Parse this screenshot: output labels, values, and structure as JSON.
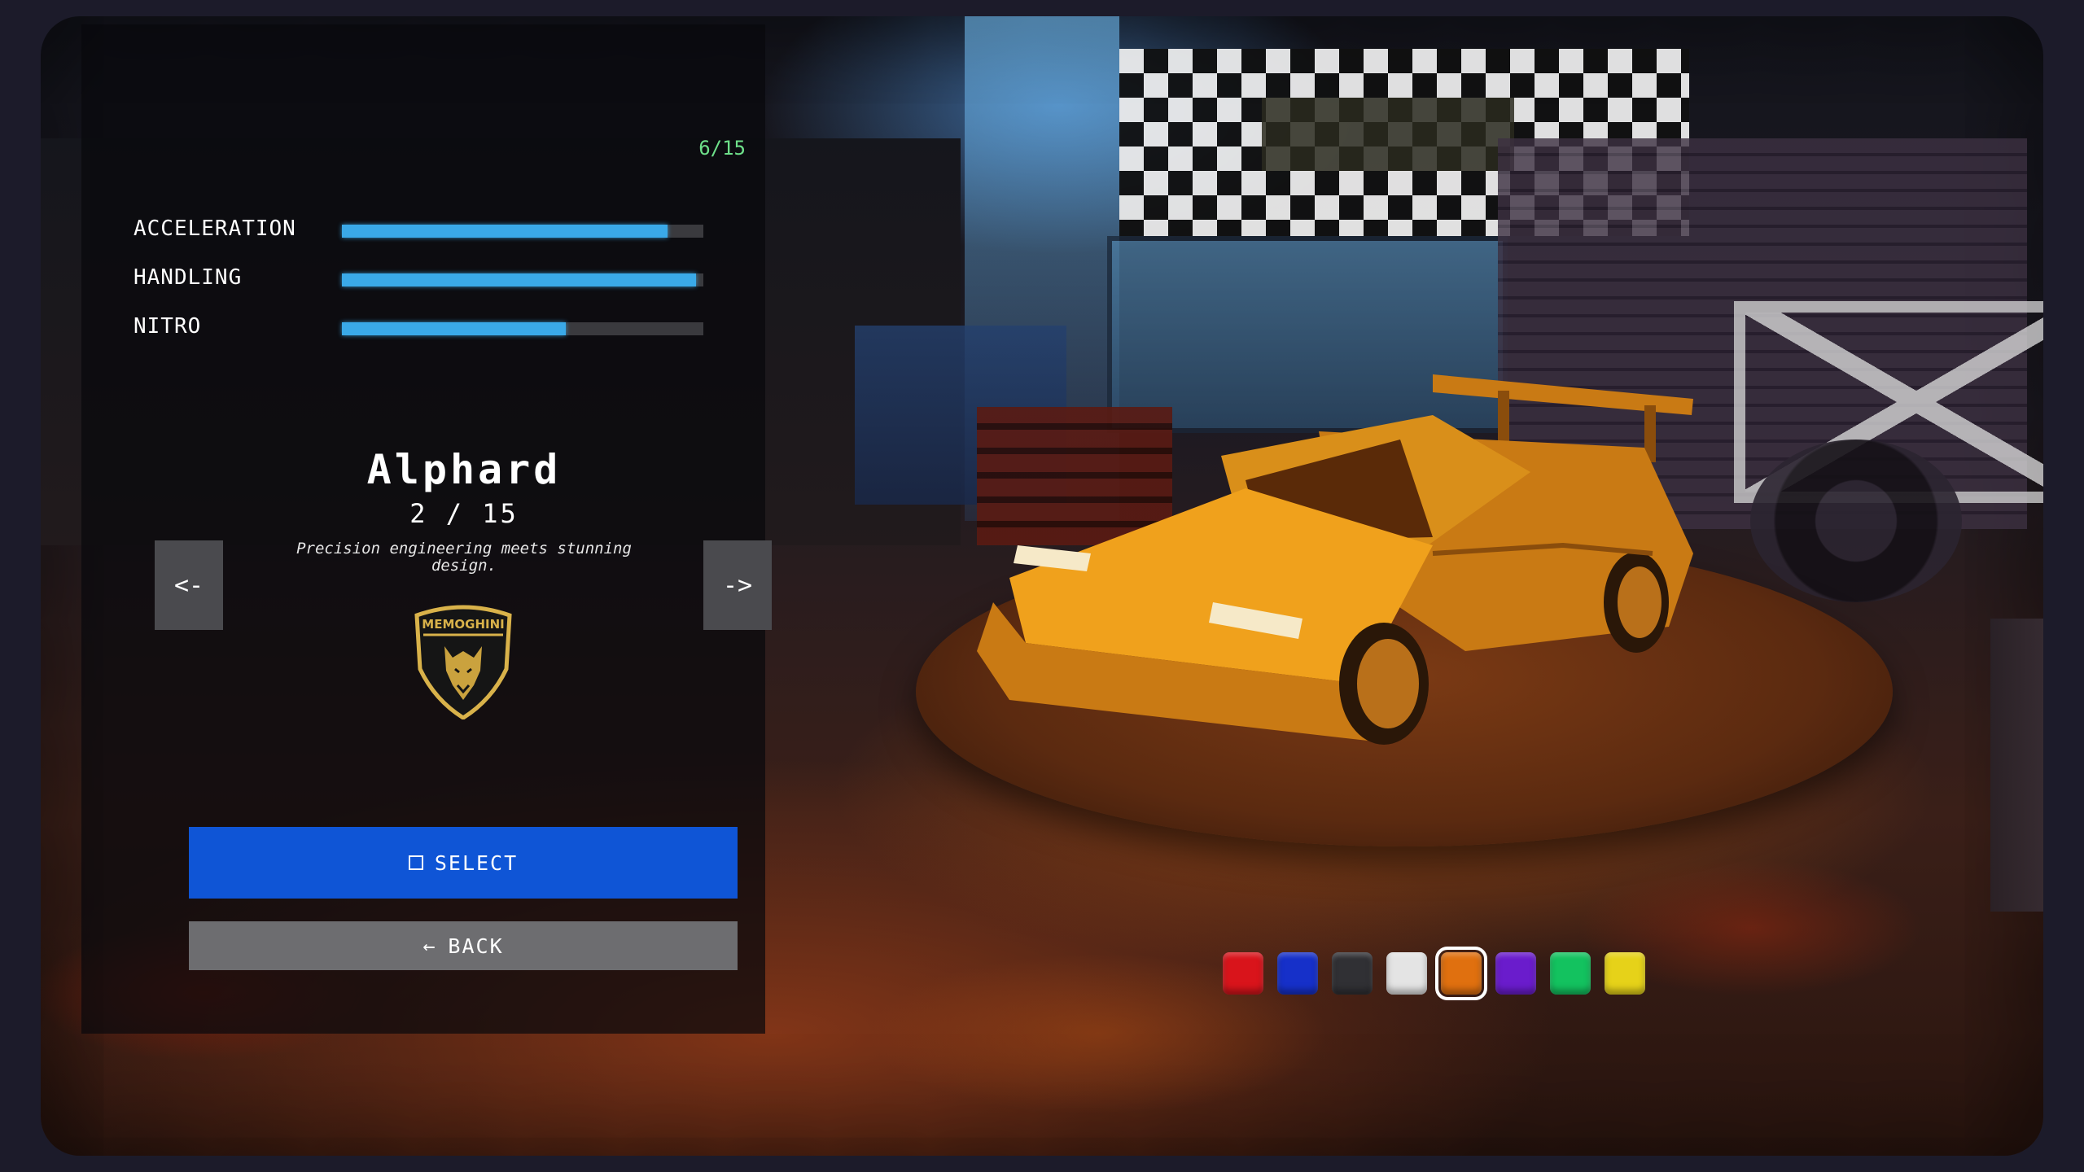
{
  "stats": {
    "unlock_count": "6/15",
    "items": [
      {
        "label": "ACCELERATION",
        "fill": 0.9
      },
      {
        "label": "HANDLING",
        "fill": 0.98
      },
      {
        "label": "NITRO",
        "fill": 0.62
      }
    ]
  },
  "car": {
    "name": "Alphard",
    "index": "2 / 15",
    "description": "Precision engineering meets stunning design.",
    "brand_logo_text": "MEMOGHINI",
    "prev_label": "<-",
    "next_label": "->",
    "body_color": "#f0a11c"
  },
  "buttons": {
    "select_label": "SELECT",
    "back_label": "BACK",
    "back_arrow": "←"
  },
  "colors": {
    "selected_index": 4,
    "swatches": [
      "#d9141b",
      "#1630c9",
      "#303034",
      "#e4e4e4",
      "#e0700f",
      "#6a1ccc",
      "#13c25f",
      "#e6d219"
    ]
  }
}
